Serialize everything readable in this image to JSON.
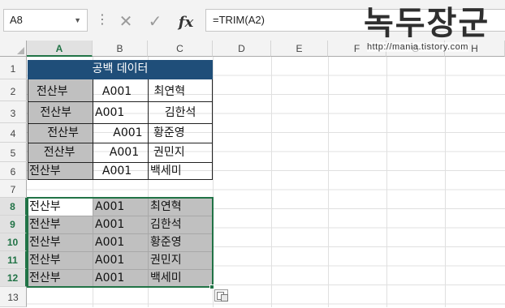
{
  "name_box": {
    "value": "A8"
  },
  "formula_bar": {
    "cancel_glyph": "✕",
    "enter_glyph": "✓",
    "fx_label": "fx",
    "formula": "=TRIM(A2)"
  },
  "watermark": {
    "title": "녹두장군",
    "url": "http://mania.tistory.com"
  },
  "columns": [
    "A",
    "B",
    "C",
    "D",
    "E",
    "F",
    "G",
    "H"
  ],
  "rows": [
    "1",
    "2",
    "3",
    "4",
    "5",
    "6",
    "7",
    "8",
    "9",
    "10",
    "11",
    "12",
    "13"
  ],
  "selected_column": "A",
  "selected_rows": [
    "8",
    "9",
    "10",
    "11",
    "12"
  ],
  "table": {
    "title": "공백 데이터",
    "source_rows": [
      [
        "  전산부",
        "  A001",
        " 최연혁"
      ],
      [
        "   전산부",
        "A001",
        "    김한석"
      ],
      [
        "     전산부",
        "     A001",
        "황준영"
      ],
      [
        "    전산부",
        "    A001",
        "권민지"
      ],
      [
        "전산부",
        "  A001",
        "백세미"
      ]
    ],
    "trimmed_rows": [
      [
        "전산부",
        "A001",
        "최연혁"
      ],
      [
        "전산부",
        "A001",
        "김한석"
      ],
      [
        "전산부",
        "A001",
        "황준영"
      ],
      [
        "전산부",
        "A001",
        "권민지"
      ],
      [
        "전산부",
        "A001",
        "백세미"
      ]
    ]
  },
  "colors": {
    "header_fill": "#1f4e79",
    "gray_fill": "#c0c0c0",
    "selection": "#217346"
  },
  "icons": [
    "chevron-down-icon",
    "more-dots-icon",
    "cancel-icon",
    "enter-check-icon",
    "paste-options-icon"
  ]
}
